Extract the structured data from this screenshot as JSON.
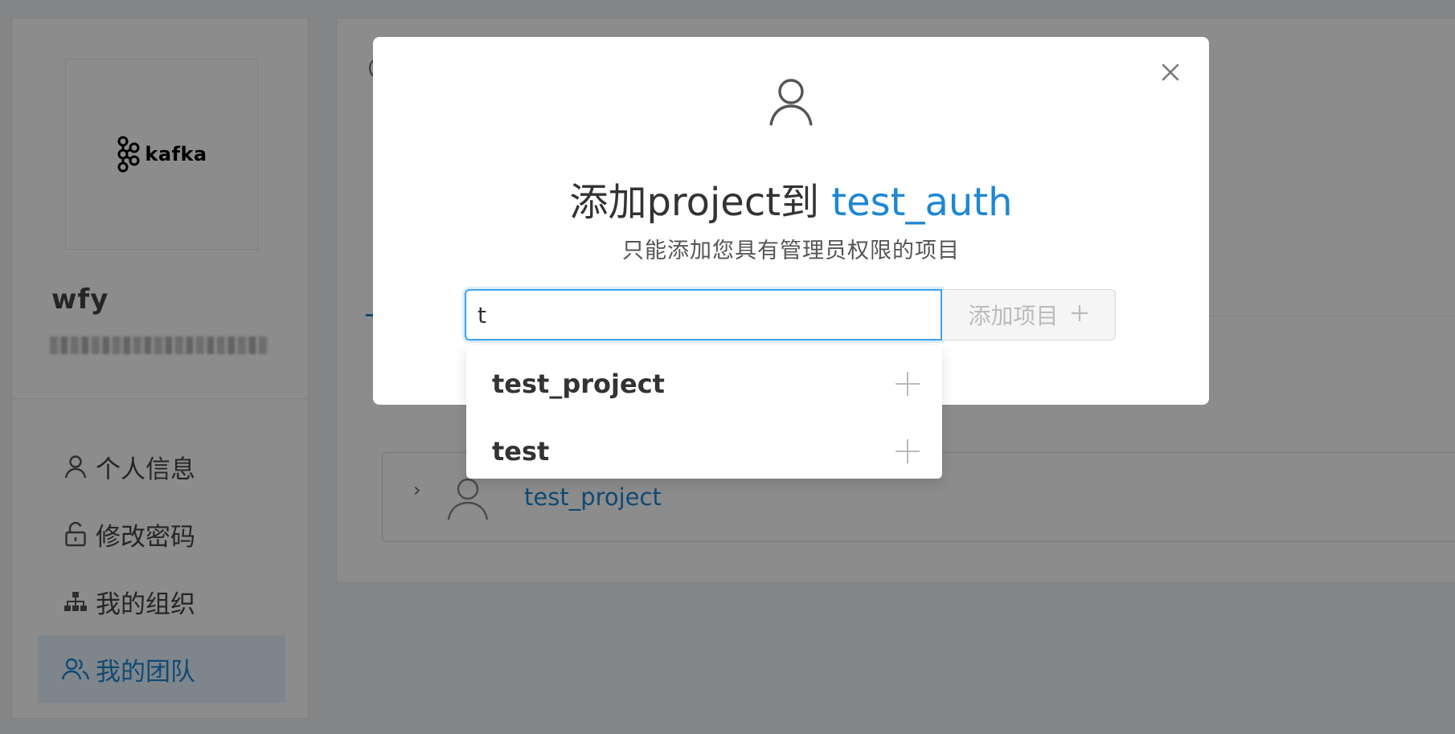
{
  "sidebar": {
    "logo_text": "kafka",
    "user_name": "wfy",
    "nav": [
      {
        "label": "个人信息",
        "icon": "user-icon"
      },
      {
        "label": "修改密码",
        "icon": "lock-icon"
      },
      {
        "label": "我的组织",
        "icon": "org-chart-icon"
      },
      {
        "label": "我的团队",
        "icon": "team-icon",
        "active": true
      }
    ]
  },
  "main": {
    "team_row": {
      "name": "test_project"
    }
  },
  "modal": {
    "title_prefix": "添加project到 ",
    "title_team": "test_auth",
    "subtitle": "只能添加您具有管理员权限的项目",
    "input_value": "t",
    "add_button_label": "添加项目",
    "options": [
      {
        "label": "test_project"
      },
      {
        "label": "test"
      }
    ]
  },
  "colors": {
    "accent": "#1e87d4",
    "input_focus": "#3ea3f0",
    "active_bg": "#e6f4ff"
  }
}
